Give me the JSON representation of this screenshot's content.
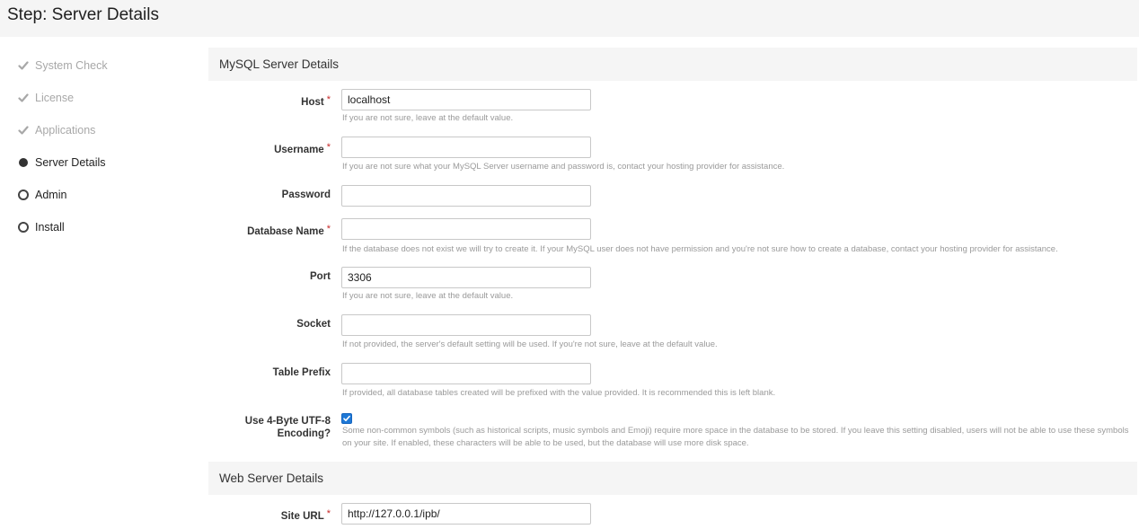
{
  "header": {
    "title": "Step: Server Details"
  },
  "steps": [
    {
      "label": "System Check",
      "state": "done"
    },
    {
      "label": "License",
      "state": "done"
    },
    {
      "label": "Applications",
      "state": "done"
    },
    {
      "label": "Server Details",
      "state": "current"
    },
    {
      "label": "Admin",
      "state": "todo"
    },
    {
      "label": "Install",
      "state": "todo"
    }
  ],
  "mysql": {
    "heading": "MySQL Server Details",
    "host": {
      "label": "Host",
      "required": "*",
      "value": "localhost",
      "help": "If you are not sure, leave at the default value."
    },
    "username": {
      "label": "Username",
      "required": "*",
      "value": "",
      "help": "If you are not sure what your MySQL Server username and password is, contact your hosting provider for assistance."
    },
    "password": {
      "label": "Password",
      "value": ""
    },
    "database": {
      "label": "Database Name",
      "required": "*",
      "value": "",
      "help": "If the database does not exist we will try to create it. If your MySQL user does not have permission and you're not sure how to create a database, contact your hosting provider for assistance."
    },
    "port": {
      "label": "Port",
      "value": "3306",
      "help": "If you are not sure, leave at the default value."
    },
    "socket": {
      "label": "Socket",
      "value": "",
      "help": "If not provided, the server's default setting will be used. If you're not sure, leave at the default value."
    },
    "prefix": {
      "label": "Table Prefix",
      "value": "",
      "help": "If provided, all database tables created will be prefixed with the value provided. It is recommended this is left blank."
    },
    "utf8": {
      "label_line1": "Use 4-Byte UTF-8",
      "label_line2": "Encoding?",
      "checked": true,
      "help_line1": "Some non-common symbols (such as historical scripts, music symbols and Emoji) require more space in the database to be stored. If you leave this setting disabled, users will not be able to use these symbols",
      "help_line2": "on your site. If enabled, these characters will be able to be used, but the database will use more disk space."
    }
  },
  "web": {
    "heading": "Web Server Details",
    "site_url": {
      "label": "Site URL",
      "required": "*",
      "value": "http://127.0.0.1/ipb/"
    }
  },
  "colors": {
    "header_bg": "#f5f5f5",
    "required": "#c82a2a",
    "checkbox": "#1e78d6",
    "help_text": "#9a9a9a",
    "done_step": "#a8a8a8"
  },
  "icons": {
    "done": "check-icon",
    "current": "filled-circle-icon",
    "todo": "empty-circle-icon",
    "checkbox": "checkmark-icon"
  }
}
